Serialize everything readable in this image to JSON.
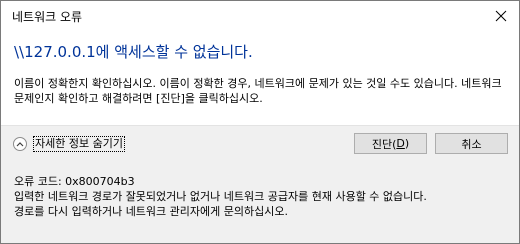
{
  "window": {
    "title": "네트워크 오류",
    "close_icon": "close-x"
  },
  "main": {
    "headline": "\\\\127.0.0.1에 액세스할 수 없습니다.",
    "description": "이름이 정확한지 확인하십시오. 이름이 정확한 경우, 네트워크에 문제가 있는 것일 수도 있습니다. 네트워크 문제인지 확인하고 해결하려면 [진단]을 클릭하십시오."
  },
  "buttons": {
    "toggle_details_label": "자세한 정보 숨기기",
    "toggle_icon": "chevron-up-circle",
    "diagnose_label": "진단(",
    "diagnose_accel": "D",
    "diagnose_suffix": ")",
    "cancel_label": "취소"
  },
  "details": {
    "error_code": "오류 코드: 0x800704b3",
    "line1": "입력한 네트워크 경로가 잘못되었거나 없거나 네트워크 공급자를 현재 사용할 수 없습니다.",
    "line2": "경로를 다시 입력하거나 네트워크 관리자에게 문의하십시오."
  },
  "colors": {
    "headline": "#003399",
    "panel_bg": "#f0f0f0",
    "button_bg": "#e1e1e1",
    "button_border": "#adadad"
  }
}
